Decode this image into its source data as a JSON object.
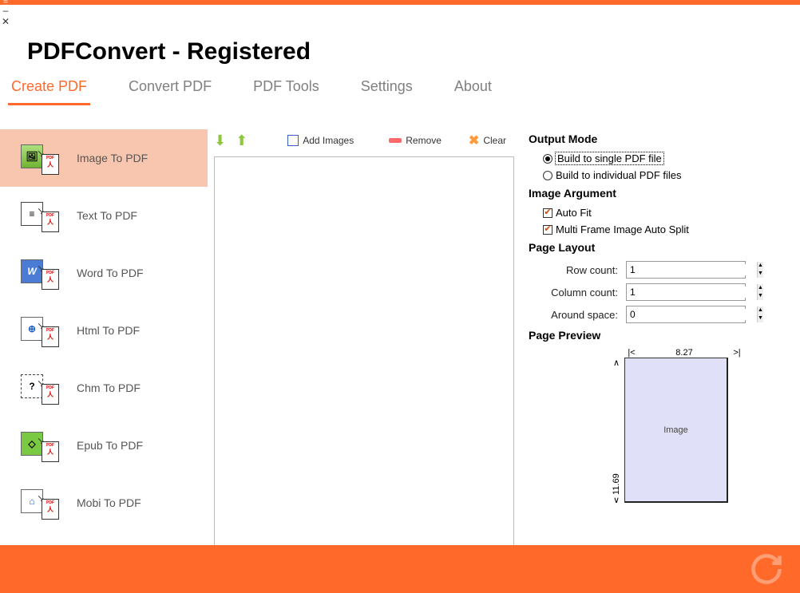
{
  "window": {
    "title": "PDFConvert - Registered"
  },
  "tabs": [
    {
      "id": "create",
      "label": "Create PDF",
      "active": true
    },
    {
      "id": "convert",
      "label": "Convert PDF",
      "active": false
    },
    {
      "id": "tools",
      "label": "PDF Tools",
      "active": false
    },
    {
      "id": "settings",
      "label": "Settings",
      "active": false
    },
    {
      "id": "about",
      "label": "About",
      "active": false
    }
  ],
  "sidebar": [
    {
      "id": "image",
      "label": "Image To PDF",
      "active": true
    },
    {
      "id": "text",
      "label": "Text To PDF",
      "active": false
    },
    {
      "id": "word",
      "label": "Word To PDF",
      "active": false
    },
    {
      "id": "html",
      "label": "Html To PDF",
      "active": false
    },
    {
      "id": "chm",
      "label": "Chm To PDF",
      "active": false
    },
    {
      "id": "epub",
      "label": "Epub To PDF",
      "active": false
    },
    {
      "id": "mobi",
      "label": "Mobi To PDF",
      "active": false
    }
  ],
  "toolbar": {
    "add_images": "Add Images",
    "remove": "Remove",
    "clear": "Clear"
  },
  "output_mode": {
    "heading": "Output Mode",
    "single": "Build to single PDF file",
    "individual": "Build to individual PDF files",
    "selected": "single"
  },
  "image_argument": {
    "heading": "Image Argument",
    "auto_fit": {
      "label": "Auto Fit",
      "checked": true
    },
    "auto_split": {
      "label": "Multi Frame Image Auto Split",
      "checked": true
    }
  },
  "page_layout": {
    "heading": "Page Layout",
    "row_count": {
      "label": "Row count:",
      "value": "1"
    },
    "column_count": {
      "label": "Column count:",
      "value": "1"
    },
    "around_space": {
      "label": "Around space:",
      "value": "0"
    }
  },
  "page_preview": {
    "heading": "Page Preview",
    "width": "8.27",
    "height": "11.69",
    "placeholder": "Image"
  }
}
